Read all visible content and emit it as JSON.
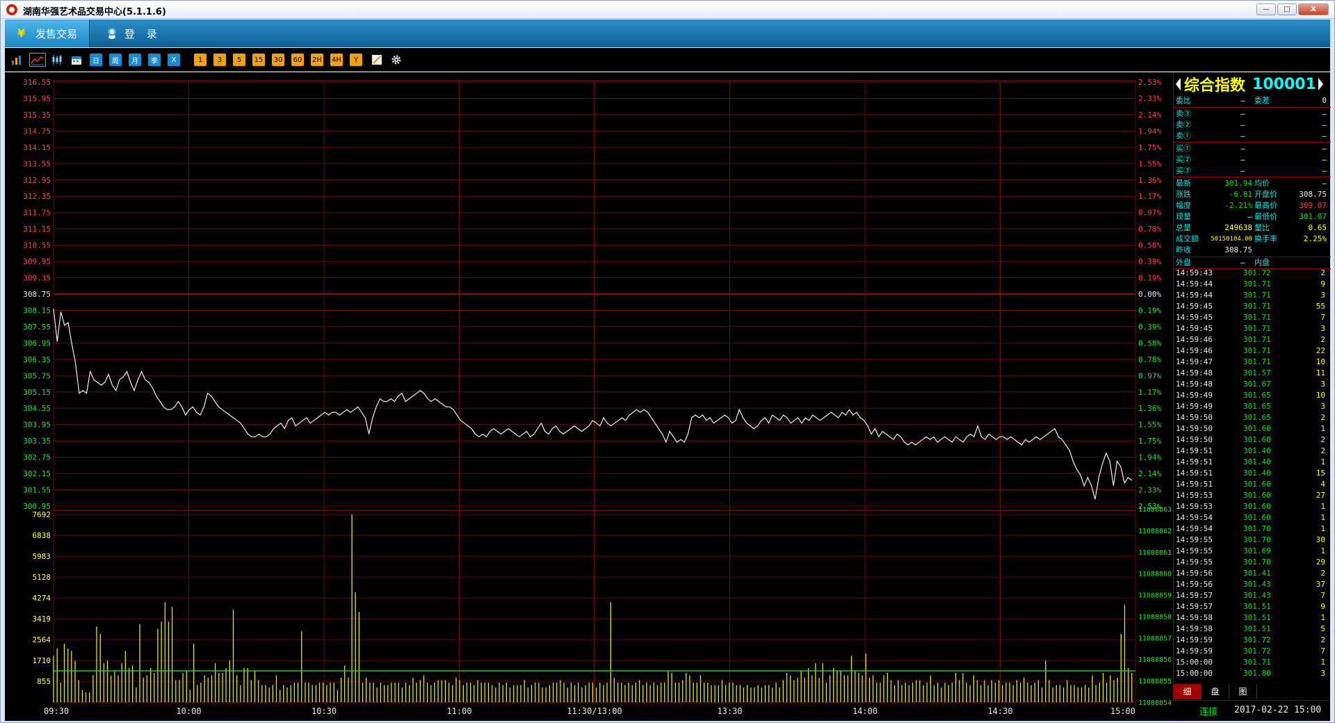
{
  "window": {
    "title": "湖南华强艺术品交易中心(5.1.1.6)",
    "minimize_label": "—",
    "restore_label": "□",
    "close_label": "X"
  },
  "menu": {
    "tabs": [
      {
        "label": "发售交易"
      },
      {
        "label": "登 录"
      }
    ]
  },
  "toolbar": {
    "period_buttons": [
      "日",
      "周",
      "月",
      "季",
      "X"
    ],
    "minute_buttons": [
      "1",
      "3",
      "5",
      "15",
      "30",
      "60",
      "2H",
      "4H",
      "Y"
    ]
  },
  "quote": {
    "name": "综合指数",
    "code": "100001",
    "weibi_label": "委比",
    "weibi_value": "—",
    "weicha_label": "委差",
    "weicha_value": "0",
    "sell": [
      {
        "label": "卖③",
        "price": "—",
        "vol": "—"
      },
      {
        "label": "卖②",
        "price": "—",
        "vol": "—"
      },
      {
        "label": "卖①",
        "price": "—",
        "vol": "—"
      }
    ],
    "buy": [
      {
        "label": "买①",
        "price": "—",
        "vol": "—"
      },
      {
        "label": "买②",
        "price": "—",
        "vol": "—"
      },
      {
        "label": "买③",
        "price": "—",
        "vol": "—"
      }
    ],
    "stats": [
      {
        "l1": "最新",
        "v1": "301.94",
        "c1": "c-green",
        "l2": "均价",
        "v2": "—",
        "c2": "c-white"
      },
      {
        "l1": "涨跌",
        "v1": "-6.81",
        "c1": "c-green",
        "l2": "开盘价",
        "v2": "308.75",
        "c2": "c-white"
      },
      {
        "l1": "幅度",
        "v1": "-2.21%",
        "c1": "c-green",
        "l2": "最高价",
        "v2": "309.07",
        "c2": "c-red"
      },
      {
        "l1": "现量",
        "v1": "—",
        "c1": "c-white",
        "l2": "最低价",
        "v2": "301.07",
        "c2": "c-green"
      },
      {
        "l1": "总量",
        "v1": "249638",
        "c1": "c-yellow",
        "l2": "量比",
        "v2": "0.65",
        "c2": "c-yellow"
      },
      {
        "l1": "成交额",
        "v1": "50150104.00",
        "c1": "c-yellow",
        "l2": "换手率",
        "v2": "2.25%",
        "c2": "c-yellow"
      },
      {
        "l1": "昨收",
        "v1": "308.75",
        "c1": "c-white",
        "l2": "",
        "v2": "",
        "c2": "c-white"
      }
    ],
    "waipan_label": "外盘",
    "waipan_value": "—",
    "neipan_label": "内盘",
    "neipan_value": "",
    "ticks": [
      [
        "14:59:43",
        "301.72",
        "2"
      ],
      [
        "14:59:44",
        "301.71",
        "9"
      ],
      [
        "14:59:44",
        "301.71",
        "3"
      ],
      [
        "14:59:45",
        "301.71",
        "55"
      ],
      [
        "14:59:45",
        "301.71",
        "7"
      ],
      [
        "14:59:45",
        "301.71",
        "3"
      ],
      [
        "14:59:46",
        "301.71",
        "2"
      ],
      [
        "14:59:46",
        "301.71",
        "22"
      ],
      [
        "14:59:47",
        "301.71",
        "10"
      ],
      [
        "14:59:48",
        "301.57",
        "11"
      ],
      [
        "14:59:48",
        "301.67",
        "3"
      ],
      [
        "14:59:49",
        "301.65",
        "10"
      ],
      [
        "14:59:49",
        "301.65",
        "3"
      ],
      [
        "14:59:50",
        "301.65",
        "2"
      ],
      [
        "14:59:50",
        "301.60",
        "1"
      ],
      [
        "14:59:50",
        "301.60",
        "2"
      ],
      [
        "14:59:51",
        "301.40",
        "2"
      ],
      [
        "14:59:51",
        "301.40",
        "1"
      ],
      [
        "14:59:51",
        "301.40",
        "15"
      ],
      [
        "14:59:51",
        "301.60",
        "4"
      ],
      [
        "14:59:53",
        "301.60",
        "27"
      ],
      [
        "14:59:53",
        "301.60",
        "1"
      ],
      [
        "14:59:54",
        "301.60",
        "1"
      ],
      [
        "14:59:54",
        "301.70",
        "1"
      ],
      [
        "14:59:55",
        "301.70",
        "30"
      ],
      [
        "14:59:55",
        "301.69",
        "1"
      ],
      [
        "14:59:55",
        "301.70",
        "29"
      ],
      [
        "14:59:56",
        "301.41",
        "2"
      ],
      [
        "14:59:56",
        "301.43",
        "37"
      ],
      [
        "14:59:57",
        "301.43",
        "7"
      ],
      [
        "14:59:57",
        "301.51",
        "9"
      ],
      [
        "14:59:58",
        "301.51",
        "1"
      ],
      [
        "14:59:58",
        "301.51",
        "5"
      ],
      [
        "14:59:59",
        "301.72",
        "2"
      ],
      [
        "14:59:59",
        "301.72",
        "7"
      ],
      [
        "15:00:00",
        "301.71",
        "1"
      ],
      [
        "15:00:00",
        "301.80",
        "3"
      ]
    ],
    "bottom_tabs": [
      "细",
      "盘",
      "图"
    ]
  },
  "status": {
    "connection": "连接",
    "time": "2017-02-22 15:00"
  },
  "chart_data": {
    "type": "line",
    "prev_close": 308.75,
    "price_axis_labels": [
      "316.55",
      "315.95",
      "315.35",
      "314.75",
      "314.15",
      "313.55",
      "312.95",
      "312.35",
      "311.75",
      "311.15",
      "310.55",
      "309.95",
      "309.35",
      "308.75",
      "308.15",
      "307.55",
      "306.95",
      "306.35",
      "305.75",
      "305.15",
      "304.55",
      "303.95",
      "303.35",
      "302.75",
      "302.15",
      "301.55",
      "300.95"
    ],
    "pct_axis_labels": [
      "2.53%",
      "2.33%",
      "2.14%",
      "1.94%",
      "1.75%",
      "1.55%",
      "1.36%",
      "1.17%",
      "0.97%",
      "0.78%",
      "0.58%",
      "0.39%",
      "0.19%",
      "0.00%",
      "0.19%",
      "0.39%",
      "0.58%",
      "0.78%",
      "0.97%",
      "1.17%",
      "1.36%",
      "1.55%",
      "1.75%",
      "1.94%",
      "2.14%",
      "2.33%",
      "2.53%"
    ],
    "ylim": [
      300.95,
      316.55
    ],
    "volume_axis_labels": [
      "7692",
      "6838",
      "5983",
      "5128",
      "4274",
      "3419",
      "2564",
      "1710",
      "855"
    ],
    "volume_ylim": [
      0,
      7692
    ],
    "open_interest_axis_labels": [
      "11088863",
      "11088862",
      "11088861",
      "11088860",
      "11088859",
      "11088858",
      "11088857",
      "11088856",
      "11088855",
      "11088854"
    ],
    "time_labels": [
      "09:30",
      "10:00",
      "10:30",
      "11:00",
      "11:30/13:00",
      "13:30",
      "14:00",
      "14:30",
      "15:00"
    ],
    "series": [
      {
        "values": [
          308.2,
          307.0,
          308.1,
          307.6,
          307.7,
          306.9,
          306.2,
          305.1,
          305.2,
          305.1,
          305.9,
          305.6,
          305.5,
          305.4,
          305.5,
          305.8,
          305.4,
          305.2,
          305.6,
          305.7,
          305.9,
          305.5,
          305.2,
          305.6,
          305.9,
          305.6,
          305.5,
          305.3,
          305.0,
          304.8,
          304.6,
          304.5,
          304.5,
          304.6,
          304.8,
          304.6,
          304.3,
          304.5,
          304.6,
          304.4,
          304.3,
          304.6,
          305.1,
          305.0,
          304.8,
          304.6,
          304.5,
          304.4,
          304.3,
          304.2,
          304.1,
          304.0,
          303.8,
          303.6,
          303.5,
          303.5,
          303.6,
          303.5,
          303.5,
          303.6,
          303.8,
          303.9,
          304.0,
          303.8,
          304.1,
          304.2,
          303.9,
          304.0,
          304.1,
          304.2,
          304.0,
          304.1,
          304.2,
          304.3,
          304.4,
          304.3,
          304.4,
          304.4,
          304.3,
          304.4,
          304.5,
          304.4,
          304.5,
          304.6,
          304.4,
          304.2,
          303.6,
          304.2,
          304.6,
          304.9,
          304.8,
          304.8,
          304.9,
          304.8,
          305.0,
          305.1,
          304.8,
          304.9,
          305.0,
          305.1,
          305.2,
          305.1,
          304.9,
          304.8,
          304.9,
          304.8,
          304.7,
          304.6,
          304.6,
          304.5,
          304.3,
          304.1,
          304.0,
          303.9,
          303.8,
          303.6,
          303.5,
          303.6,
          303.5,
          303.7,
          303.8,
          303.7,
          303.6,
          303.7,
          303.8,
          303.7,
          303.6,
          303.5,
          303.6,
          303.7,
          303.5,
          303.6,
          303.8,
          304.0,
          303.7,
          303.6,
          303.8,
          303.9,
          303.7,
          303.6,
          303.7,
          303.8,
          303.9,
          303.8,
          303.7,
          303.8,
          303.9,
          304.1,
          304.0,
          303.9,
          304.2,
          304.0,
          303.9,
          304.0,
          304.1,
          304.2,
          304.1,
          304.3,
          304.4,
          304.5,
          304.4,
          304.5,
          304.4,
          304.2,
          304.0,
          303.8,
          303.6,
          303.3,
          303.7,
          303.5,
          303.3,
          303.4,
          303.3,
          303.6,
          304.2,
          304.3,
          304.2,
          304.3,
          304.1,
          304.2,
          304.0,
          304.1,
          304.2,
          304.3,
          304.2,
          304.0,
          304.1,
          304.5,
          304.2,
          304.0,
          303.9,
          303.8,
          303.9,
          304.1,
          304.2,
          304.0,
          304.3,
          304.2,
          304.1,
          304.3,
          304.2,
          304.0,
          304.1,
          304.2,
          304.0,
          304.2,
          304.1,
          304.3,
          304.2,
          304.1,
          304.2,
          304.3,
          304.4,
          304.3,
          304.2,
          304.4,
          304.3,
          304.5,
          304.3,
          304.4,
          304.2,
          304.1,
          303.9,
          303.6,
          303.8,
          303.5,
          303.7,
          303.6,
          303.5,
          303.4,
          303.6,
          303.5,
          303.3,
          303.2,
          303.3,
          303.2,
          303.3,
          303.4,
          303.5,
          303.4,
          303.5,
          303.3,
          303.4,
          303.5,
          303.4,
          303.3,
          303.5,
          303.4,
          303.3,
          303.5,
          303.6,
          303.5,
          303.9,
          303.5,
          303.4,
          303.6,
          303.5,
          303.4,
          303.5,
          303.5,
          303.4,
          303.5,
          303.4,
          303.3,
          303.2,
          303.4,
          303.3,
          303.4,
          303.5,
          303.4,
          303.5,
          303.6,
          303.7,
          303.8,
          303.5,
          303.4,
          303.2,
          303.0,
          302.6,
          302.3,
          302.1,
          301.7,
          302.0,
          301.7,
          301.2,
          302.0,
          302.5,
          302.9,
          302.6,
          301.7,
          302.6,
          302.4,
          301.8,
          302.0,
          301.9
        ]
      }
    ],
    "volumes": [
      1900,
      2200,
      800,
      2400,
      2200,
      2100,
      1700,
      900,
      500,
      400,
      400,
      1100,
      3100,
      2800,
      1600,
      1700,
      1100,
      1300,
      1100,
      1600,
      2100,
      1400,
      1500,
      600,
      3200,
      1000,
      1100,
      1400,
      1200,
      3000,
      3300,
      4100,
      3300,
      3900,
      900,
      900,
      1200,
      1300,
      500,
      2400,
      700,
      800,
      1100,
      1000,
      1100,
      1600,
      1200,
      1200,
      1400,
      1700,
      3800,
      1100,
      700,
      1400,
      1400,
      900,
      1300,
      900,
      700,
      700,
      600,
      700,
      1100,
      500,
      700,
      600,
      700,
      800,
      800,
      2900,
      800,
      800,
      700,
      700,
      800,
      800,
      700,
      800,
      800,
      500,
      1000,
      1500,
      1000,
      7692,
      4500,
      3700,
      800,
      1000,
      800,
      800,
      600,
      800,
      700,
      700,
      800,
      800,
      800,
      600,
      800,
      700,
      1000,
      800,
      900,
      1100,
      800,
      700,
      800,
      900,
      900,
      900,
      800,
      700,
      1000,
      900,
      700,
      800,
      800,
      700,
      900,
      800,
      800,
      800,
      700,
      600,
      800,
      700,
      800,
      600,
      700,
      700,
      700,
      900,
      600,
      700,
      800,
      800,
      600,
      600,
      700,
      800,
      800,
      900,
      800,
      600,
      800,
      700,
      800,
      600,
      700,
      800,
      800,
      600,
      800,
      700,
      800,
      4100,
      1000,
      800,
      800,
      700,
      800,
      700,
      800,
      900,
      700,
      800,
      700,
      800,
      700,
      800,
      800,
      1300,
      1200,
      800,
      800,
      900,
      1200,
      1100,
      800,
      800,
      1100,
      800,
      800,
      700,
      700,
      700,
      900,
      700,
      800,
      800,
      700,
      700,
      600,
      700,
      600,
      600,
      700,
      600,
      700,
      700,
      600,
      800,
      600,
      900,
      1200,
      1100,
      900,
      1000,
      1300,
      1000,
      1400,
      1100,
      1600,
      1000,
      1600,
      800,
      1100,
      1400,
      1300,
      1300,
      1100,
      1100,
      1900,
      1300,
      1200,
      1100,
      2000,
      1000,
      1100,
      800,
      800,
      1100,
      1200,
      900,
      700,
      900,
      700,
      800,
      700,
      800,
      900,
      900,
      700,
      800,
      1100,
      700,
      800,
      600,
      800,
      700,
      800,
      1200,
      900,
      1200,
      800,
      700,
      1100,
      900,
      700,
      900,
      700,
      900,
      800,
      900,
      700,
      800,
      800,
      700,
      900,
      800,
      1000,
      800,
      700,
      800,
      900,
      600,
      1700,
      900,
      600,
      700,
      700,
      600,
      900,
      700,
      700,
      600,
      600,
      700,
      600,
      1100,
      700,
      800,
      1200,
      800,
      1100,
      900,
      1000,
      2800,
      4000,
      1400,
      1200
    ]
  }
}
